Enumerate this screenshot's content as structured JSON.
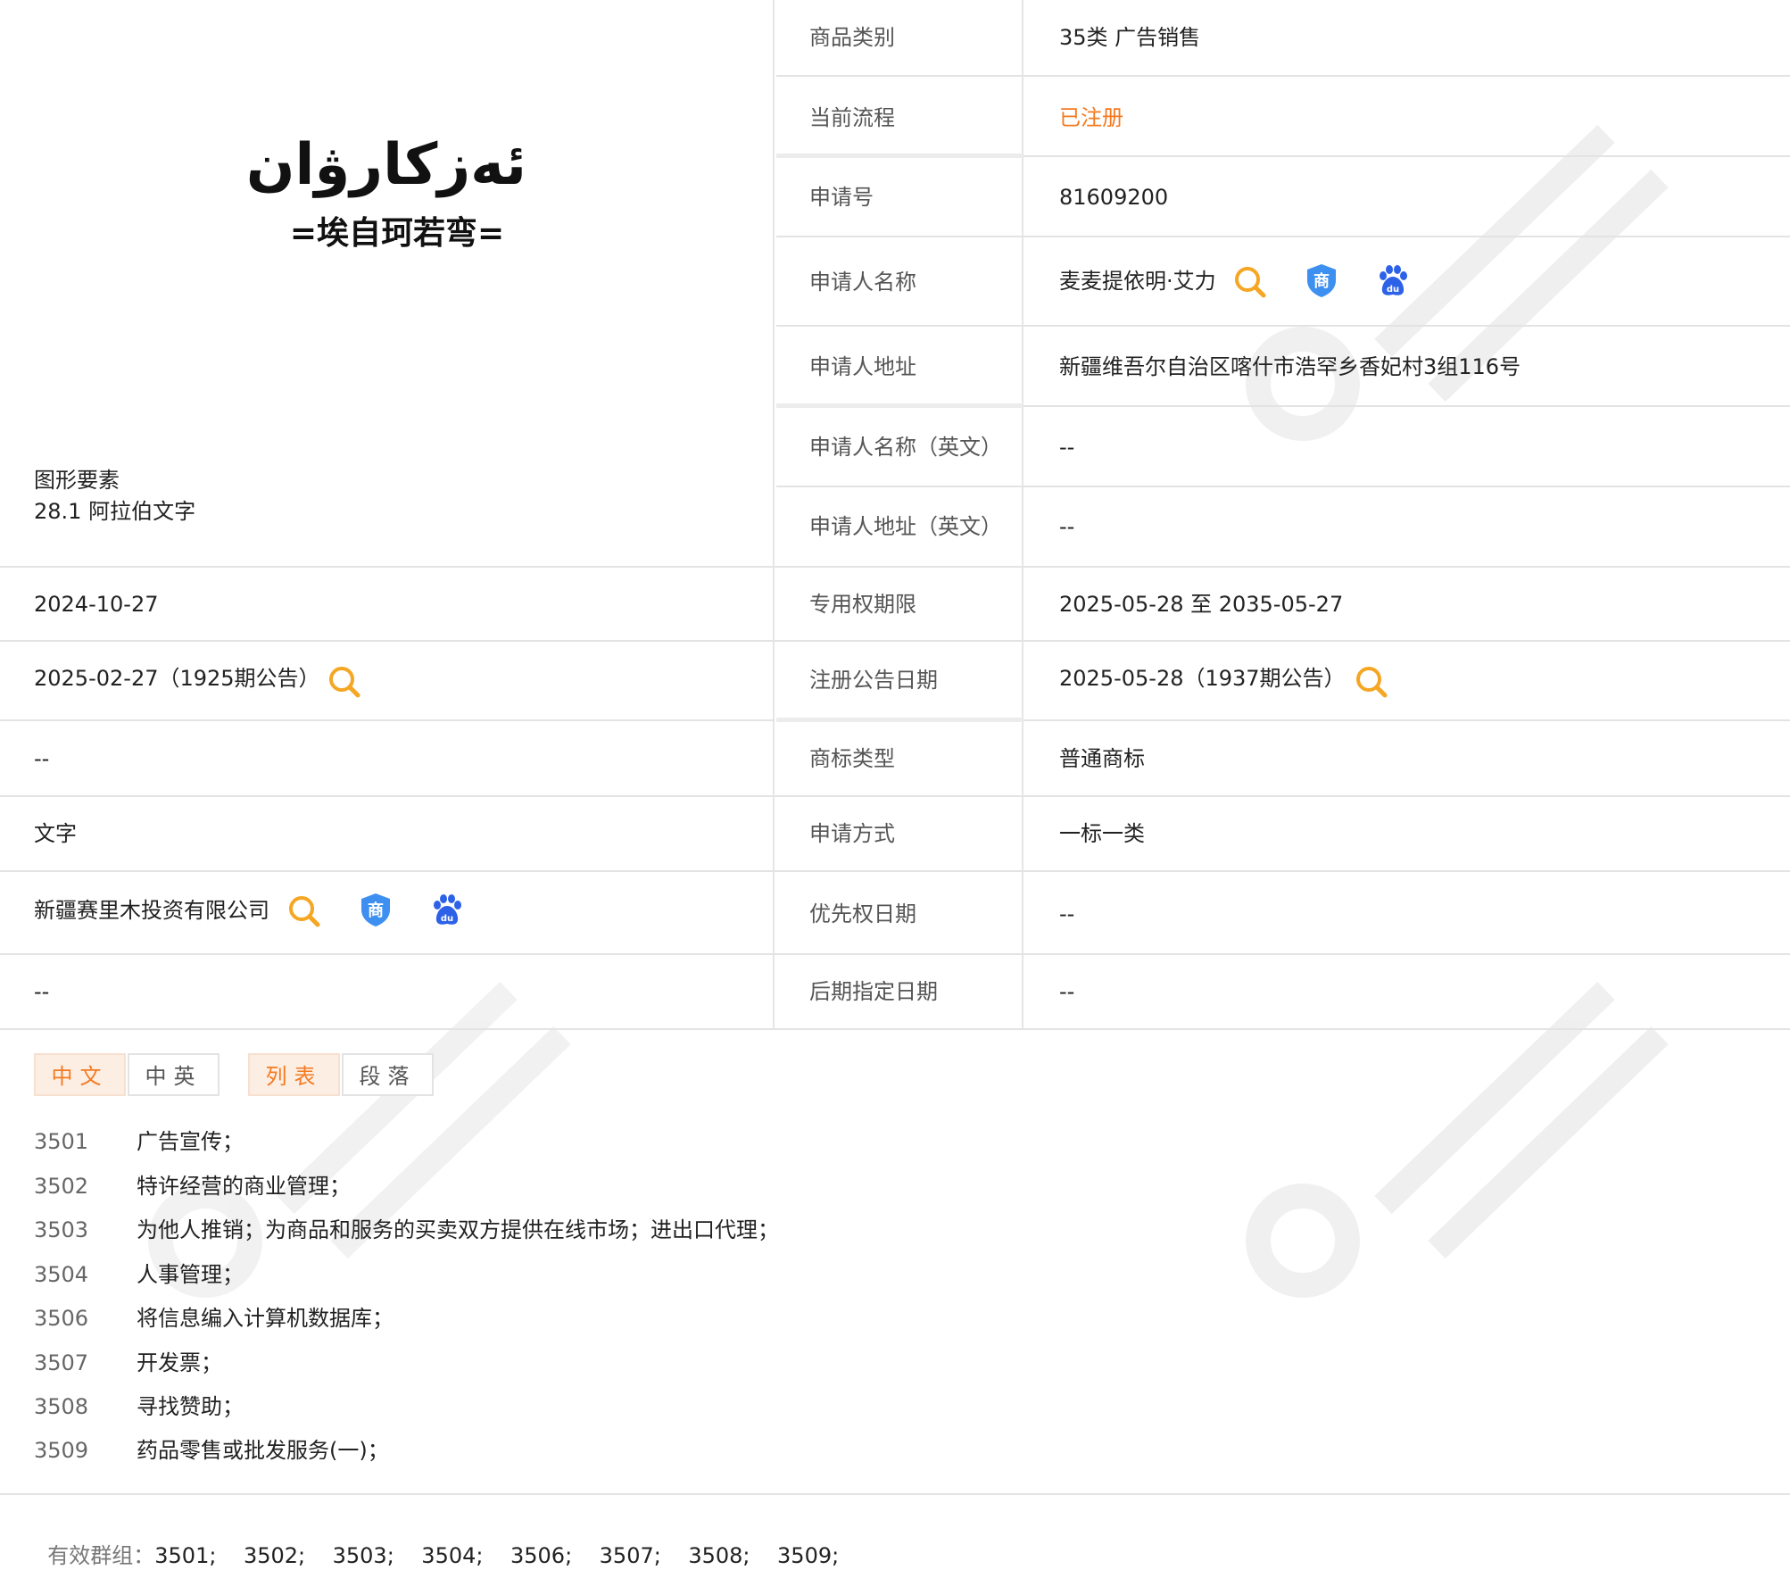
{
  "logo": {
    "arabic_text": "ئەزكارۋان",
    "chinese_text": "=埃自珂若弯="
  },
  "graphic_elements": {
    "title": "图形要素",
    "value": "28.1 阿拉伯文字"
  },
  "right_rows": [
    {
      "label": "商品类别",
      "value": "35类 广告销售"
    },
    {
      "label": "当前流程",
      "value": "已注册"
    },
    {
      "label": "申请号",
      "value": "81609200"
    },
    {
      "label": "申请人名称",
      "value": "麦麦提依明·艾力"
    },
    {
      "label": "申请人地址",
      "value": "新疆维吾尔自治区喀什市浩罕乡香妃村3组116号"
    },
    {
      "label": "申请人名称（英文）",
      "value": "--"
    },
    {
      "label": "申请人地址（英文）",
      "value": "--"
    },
    {
      "label": "专用权期限",
      "value": "2025-05-28 至 2035-05-27"
    },
    {
      "label": "注册公告日期",
      "value": "2025-05-28（1937期公告）"
    },
    {
      "label": "商标类型",
      "value": "普通商标"
    },
    {
      "label": "申请方式",
      "value": "一标一类"
    },
    {
      "label": "优先权日期",
      "value": "--"
    },
    {
      "label": "后期指定日期",
      "value": "--"
    }
  ],
  "left_rows": [
    {
      "value": "2024-10-27"
    },
    {
      "value": "2025-02-27（1925期公告）"
    },
    {
      "value": "--"
    },
    {
      "value": "文字"
    },
    {
      "value": "新疆赛里木投资有限公司"
    },
    {
      "value": "--"
    }
  ],
  "tabs": {
    "lang": [
      "中文",
      "中英"
    ],
    "view": [
      "列表",
      "段落"
    ]
  },
  "services": [
    {
      "code": "3501",
      "name": "广告宣传；"
    },
    {
      "code": "3502",
      "name": "特许经营的商业管理；"
    },
    {
      "code": "3503",
      "name": "为他人推销；为商品和服务的买卖双方提供在线市场；进出口代理；"
    },
    {
      "code": "3504",
      "name": "人事管理；"
    },
    {
      "code": "3506",
      "name": "将信息编入计算机数据库；"
    },
    {
      "code": "3507",
      "name": "开发票；"
    },
    {
      "code": "3508",
      "name": "寻找赞助；"
    },
    {
      "code": "3509",
      "name": "药品零售或批发服务(一)；"
    }
  ],
  "valid_groups": {
    "label": "有效群组：",
    "values": "3501;    3502;    3503;    3504;    3506;    3507;    3508;    3509;"
  },
  "icons": {
    "search": "search-icon",
    "trademark": "trademark-shield-icon",
    "baidu": "baidu-paw-icon"
  },
  "colors": {
    "accent": "#f47a20",
    "shield": "#3d8ff0",
    "baidu": "#2d62e8"
  }
}
